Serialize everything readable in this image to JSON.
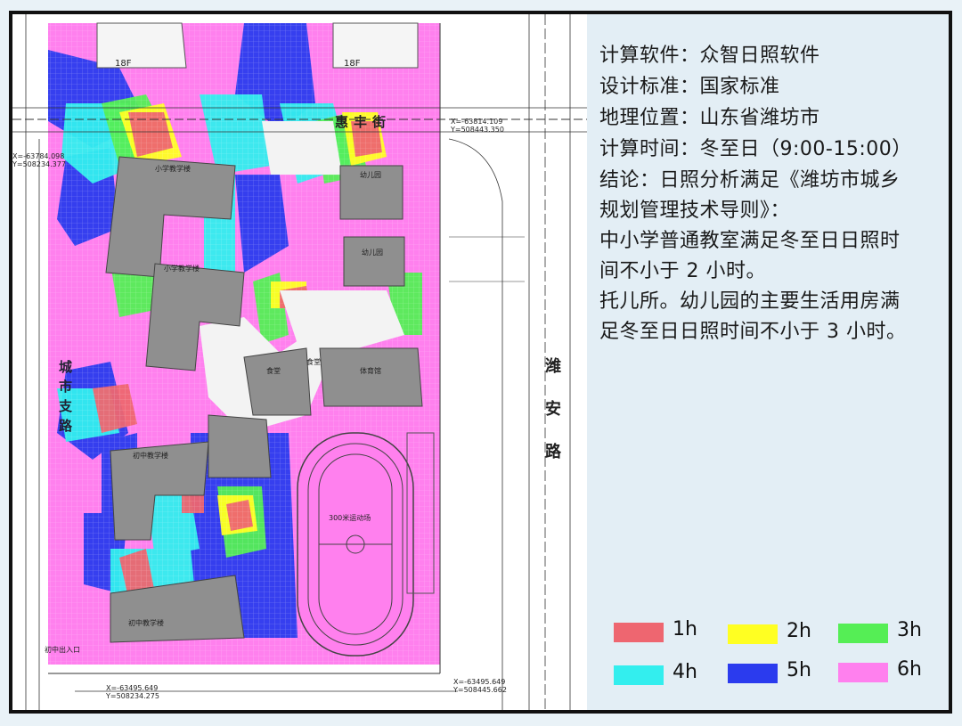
{
  "info": {
    "software": "计算软件：众智日照软件",
    "standard": "设计标准：国家标准",
    "location": "地理位置：山东省潍坊市",
    "time": "计算时间：冬至日（9:00-15:00）",
    "conclusion_1": "结论：日照分析满足《潍坊市城乡",
    "conclusion_2": "规划管理技术导则》：",
    "school_1": "中小学普通教室满足冬至日日照时",
    "school_2": "间不小于 2 小时。",
    "kinder_1": "托儿所。幼儿园的主要生活用房满",
    "kinder_2": "足冬至日日照时间不小于 3 小时。"
  },
  "legend": [
    {
      "label": "1h",
      "color": "#ee6670"
    },
    {
      "label": "2h",
      "color": "#ffff22"
    },
    {
      "label": "3h",
      "color": "#55ee55"
    },
    {
      "label": "4h",
      "color": "#33eeee"
    },
    {
      "label": "5h",
      "color": "#2b3bee"
    },
    {
      "label": "6h",
      "color": "#ff80ee"
    }
  ],
  "colors": {
    "shade_6h": "#ff80ee",
    "shade_5h": "#2b3bee",
    "shade_4h": "#33eeee",
    "shade_3h": "#55ee55",
    "shade_2h": "#ffff22",
    "shade_1h": "#ee6670",
    "building": "#8f8f8f"
  },
  "map": {
    "east_road": "潍安路",
    "west_road": "城市支路",
    "north_street": "惠丰街",
    "tower_left": "18F",
    "tower_right": "18F",
    "coord_ne": "X=-63814.109 Y=508443.350",
    "coord_nw": "X=-63784.098 Y=508234.377",
    "coord_se": "X=-63495.649 Y=508445.662",
    "coord_sw": "X=-63495.649 Y=508234.275",
    "primary_school_1": "小学教学楼",
    "primary_school_2": "小学教学楼",
    "kinder_1": "幼儿园",
    "kinder_2": "幼儿园",
    "canteen_1": "食堂",
    "canteen_2": "食堂",
    "gym": "体育馆",
    "middle_school_1": "初中教学楼",
    "middle_school_2": "初中教学楼",
    "field": "300米运动场",
    "entrance": "初中出入口"
  }
}
